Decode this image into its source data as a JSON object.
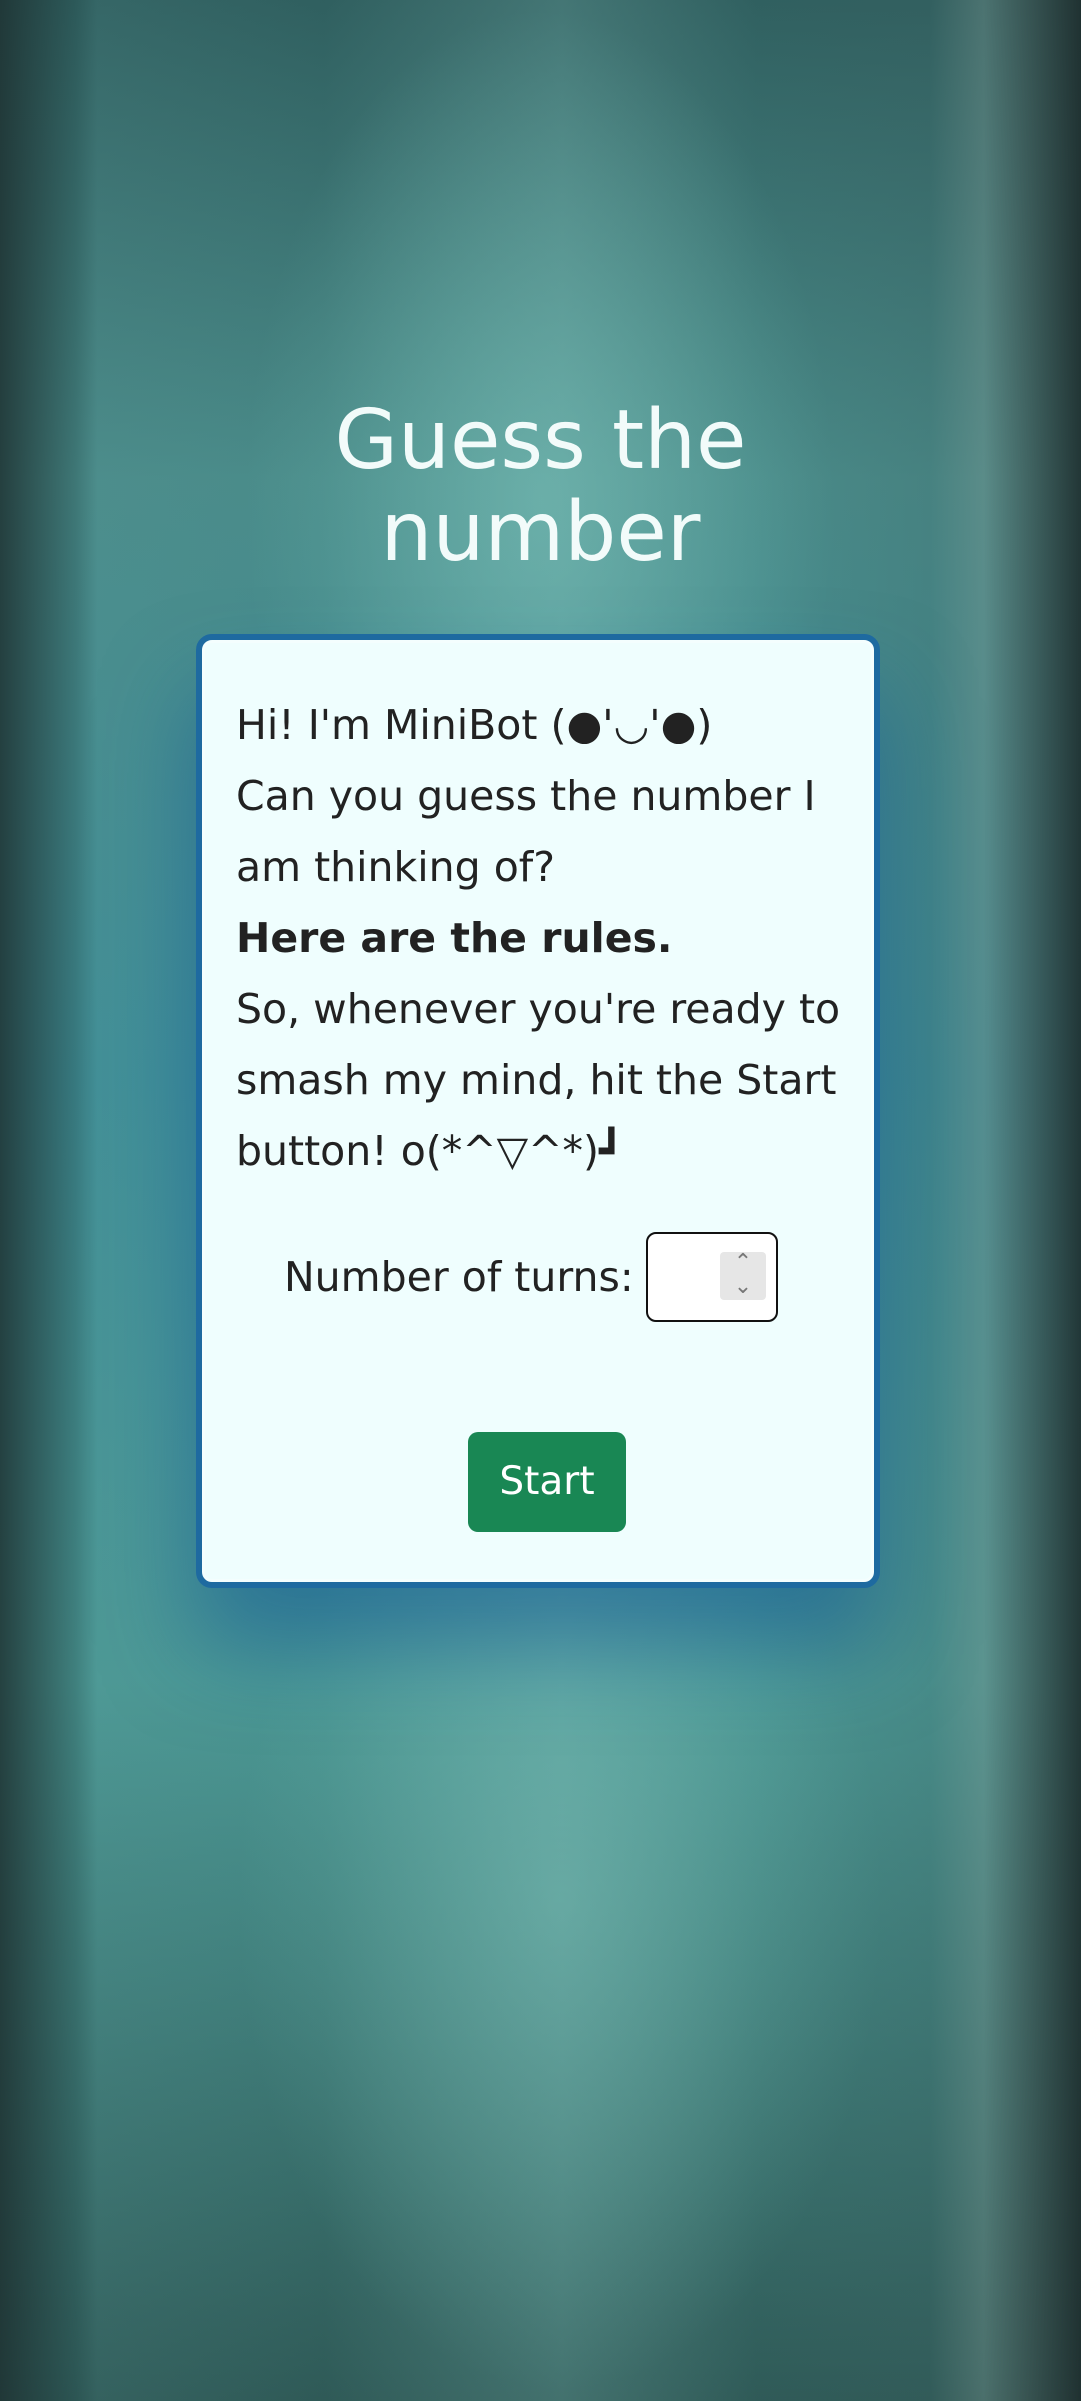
{
  "header": {
    "title_line1": "Guess the",
    "title_line2": "number"
  },
  "card": {
    "intro_line1": "Hi! I'm MiniBot (●'◡'●)",
    "intro_line2": "Can you guess the number I am thinking of?",
    "rules_link": "Here are the rules.",
    "outro": "So, whenever you're ready to smash my mind, hit the Start button! o(*^▽^*)┛",
    "turns_label": "Number of turns:",
    "turns_value": "",
    "start_label": "Start"
  },
  "colors": {
    "card_border": "#1e6aa0",
    "card_background": "#effefe",
    "start_button": "#198754"
  }
}
